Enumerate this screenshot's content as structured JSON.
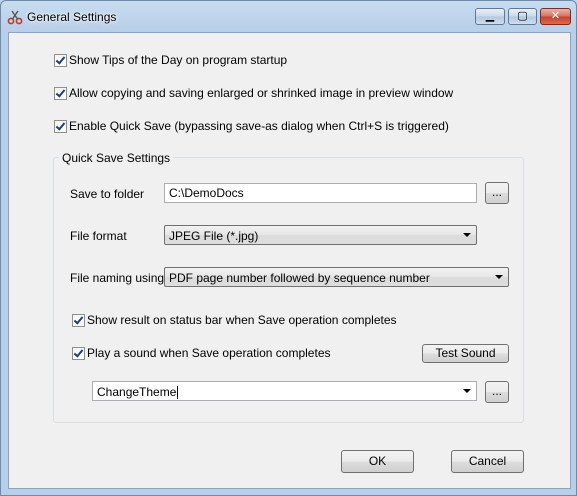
{
  "window": {
    "title": "General Settings",
    "controls": {
      "minimize": "▁",
      "maximize": "▢",
      "close": "✕"
    }
  },
  "options": {
    "show_tips": {
      "label": "Show Tips of the Day on program startup",
      "checked": true
    },
    "allow_copy": {
      "label": "Allow copying and saving enlarged or shrinked image in preview window",
      "checked": true
    },
    "quick_save": {
      "label": "Enable Quick Save (bypassing save-as dialog when Ctrl+S is triggered)",
      "checked": true
    }
  },
  "quick_save_settings": {
    "title": "Quick Save Settings",
    "save_to_folder": {
      "label": "Save to folder",
      "value": "C:\\DemoDocs",
      "browse_label": "..."
    },
    "file_format": {
      "label": "File format",
      "value": "JPEG File (*.jpg)"
    },
    "file_naming": {
      "label": "File naming using",
      "value": "PDF page number followed by sequence number"
    },
    "show_result": {
      "label": "Show result on status bar when Save operation completes",
      "checked": true
    },
    "play_sound": {
      "label": "Play a sound when Save operation completes",
      "checked": true
    },
    "test_sound_label": "Test Sound",
    "sound": {
      "value": "ChangeTheme",
      "browse_label": "..."
    }
  },
  "footer": {
    "ok_label": "OK",
    "cancel_label": "Cancel"
  },
  "colors": {
    "titlebar": "#c9dcef",
    "client": "#f0f0f0",
    "close_button": "#c5412a"
  }
}
